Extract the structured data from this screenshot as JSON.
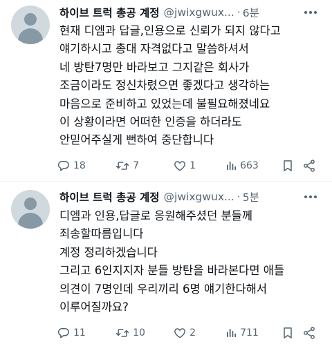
{
  "tweets": [
    {
      "display_name": "하이브 트럭 총공 계정",
      "handle": "@jwixgwux...",
      "separator": "·",
      "time": "6분",
      "lines": [
        "현재 디엠과 답글,인용으로 신뢰가 되지 않다고",
        "얘기하시고 총대 자격없다고 말씀하셔서",
        "네 방탄7명만 바라보고 그지같은 회사가",
        "조금이라도 정신차렸으면 좋겠다고 생각하는",
        "마음으로 준비하고 있었는데 불필요해졌네요",
        "이 상황이라면 어떠한 인증을 하더라도",
        "안믿어주실게 뻔하여 중단합니다"
      ],
      "replies": "18",
      "retweets": "7",
      "likes": "1",
      "views": "663"
    },
    {
      "display_name": "하이브 트럭 총공 계정",
      "handle": "@jwixgwux...",
      "separator": "·",
      "time": "5분",
      "lines": [
        "디엠과 인용,답글로 응원해주셨던 분들께",
        "죄송할따름입니다",
        "계정 정리하겠습니다",
        "그리고 6인지지자 분들 방탄을 바라본다면 애들",
        "의견이 7명인데 우리끼리 6명 얘기한다해서",
        "이루어질까요?"
      ],
      "replies": "11",
      "retweets": "10",
      "likes": "2",
      "views": "711"
    }
  ],
  "icons": {
    "avatar": "default-avatar",
    "more": "more-horizontal-icon",
    "reply": "reply-icon",
    "retweet": "retweet-icon",
    "like": "heart-icon",
    "views": "views-bar-chart-icon",
    "bookmark": "bookmark-icon",
    "share": "share-icon"
  },
  "colors": {
    "text": "#0f1419",
    "secondary": "#536471",
    "avatar_bg": "#cfd9de",
    "avatar_fg": "#8899a6",
    "divider": "#eff3f4"
  }
}
